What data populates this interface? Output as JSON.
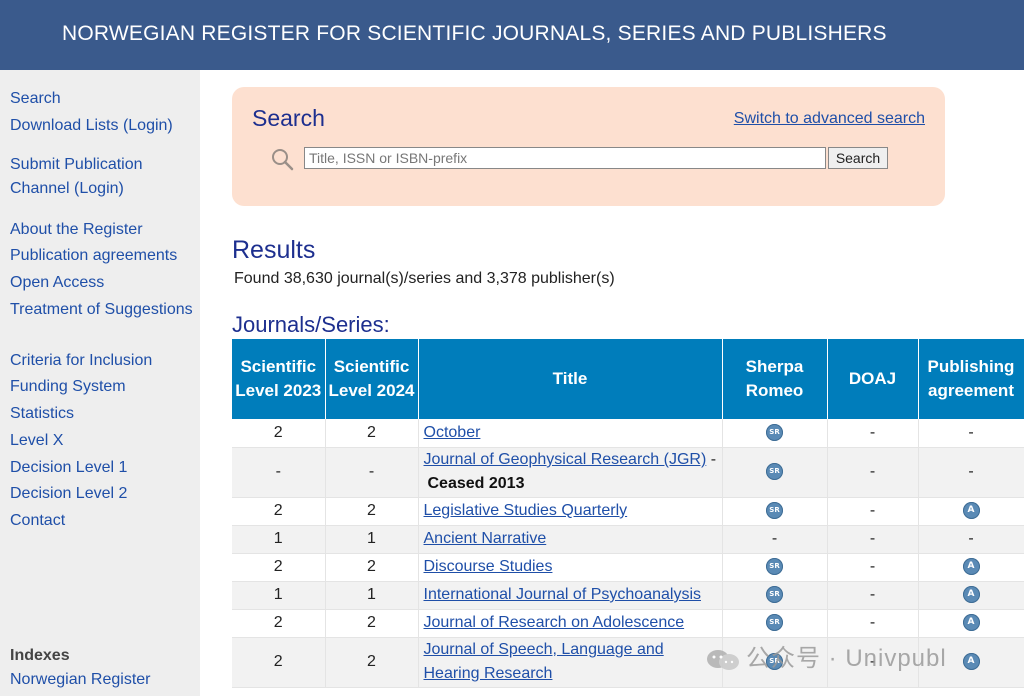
{
  "header": {
    "title": "NORWEGIAN REGISTER FOR SCIENTIFIC JOURNALS, SERIES AND PUBLISHERS"
  },
  "sidebar": {
    "items": [
      {
        "label": "Search"
      },
      {
        "label": "Download Lists (Login)"
      },
      {
        "label": "Submit Publication Channel (Login)"
      },
      {
        "label": "About the Register"
      },
      {
        "label": "Publication agreements"
      },
      {
        "label": "Open Access"
      },
      {
        "label": "Treatment of Suggestions"
      },
      {
        "label": "Criteria for Inclusion"
      },
      {
        "label": "Funding System"
      },
      {
        "label": "Statistics"
      },
      {
        "label": "Level X"
      },
      {
        "label": "Decision Level 1"
      },
      {
        "label": "Decision Level 2"
      },
      {
        "label": "Contact"
      }
    ],
    "indexes_heading": "Indexes",
    "indexes_items": [
      {
        "label": "Norwegian Register"
      }
    ]
  },
  "search": {
    "title": "Search",
    "advanced_link": "Switch to advanced search",
    "placeholder": "Title, ISSN or ISBN-prefix",
    "value": "",
    "button_label": "Search"
  },
  "results": {
    "title": "Results",
    "found_text": "Found 38,630 journal(s)/series and 3,378 publisher(s)",
    "journals_title": "Journals/Series:"
  },
  "table": {
    "headers": {
      "level2023": "Scientific Level 2023",
      "level2024": "Scientific Level 2024",
      "title": "Title",
      "sherpa": "Sherpa Romeo",
      "doaj": "DOAJ",
      "agreement": "Publishing agreement"
    },
    "rows": [
      {
        "level2023": "2",
        "level2024": "2",
        "title": "October",
        "suffix": "",
        "ceased": "",
        "sherpa": "SR",
        "doaj": "-",
        "agreement": "-"
      },
      {
        "level2023": "-",
        "level2024": "-",
        "title": "Journal of Geophysical Research (JGR)",
        "suffix": " -",
        "ceased": "Ceased 2013",
        "sherpa": "SR",
        "doaj": "-",
        "agreement": "-"
      },
      {
        "level2023": "2",
        "level2024": "2",
        "title": "Legislative Studies Quarterly",
        "suffix": "",
        "ceased": "",
        "sherpa": "SR",
        "doaj": "-",
        "agreement": "A"
      },
      {
        "level2023": "1",
        "level2024": "1",
        "title": "Ancient Narrative",
        "suffix": "",
        "ceased": "",
        "sherpa": "-",
        "doaj": "-",
        "agreement": "-"
      },
      {
        "level2023": "2",
        "level2024": "2",
        "title": "Discourse Studies",
        "suffix": "",
        "ceased": "",
        "sherpa": "SR",
        "doaj": "-",
        "agreement": "A"
      },
      {
        "level2023": "1",
        "level2024": "1",
        "title": "International Journal of Psychoanalysis",
        "suffix": "",
        "ceased": "",
        "sherpa": "SR",
        "doaj": "-",
        "agreement": "A"
      },
      {
        "level2023": "2",
        "level2024": "2",
        "title": "Journal of Research on Adolescence",
        "suffix": "",
        "ceased": "",
        "sherpa": "SR",
        "doaj": "-",
        "agreement": "A"
      },
      {
        "level2023": "2",
        "level2024": "2",
        "title": "Journal of Speech, Language and Hearing Research",
        "suffix": "",
        "ceased": "",
        "sherpa": "SR",
        "doaj": "-",
        "agreement": "A"
      }
    ]
  },
  "watermark": {
    "text": "公众号 · Univpubl"
  }
}
